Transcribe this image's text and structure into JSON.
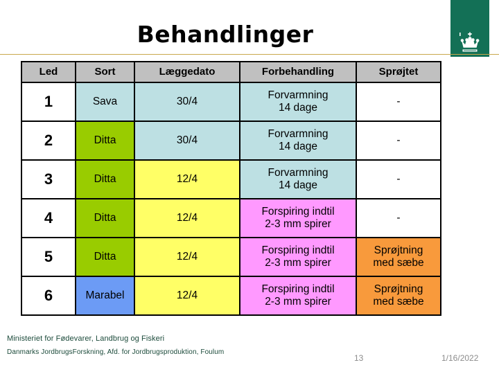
{
  "slide": {
    "title": "Behandlinger",
    "page_number": "13",
    "date": "1/16/2022",
    "accent_line_color": "#c8a84b"
  },
  "logo": {
    "name": "danish-ministry-crown-logo",
    "background_color": "#137056",
    "glyph_color": "#ffffff"
  },
  "footer": {
    "line1": "Ministeriet for Fødevarer, Landbrug og Fiskeri",
    "line2": "Danmarks JordbrugsForskning, Afd. for Jordbrugsproduktion, Foulum",
    "text_color": "#1b4a3a"
  },
  "table": {
    "headers": [
      "Led",
      "Sort",
      "Læggedato",
      "Forbehandling",
      "Sprøjtet"
    ],
    "header_background": "#c0c0c0",
    "palette": {
      "blue": "#bde0e3",
      "green": "#99cc00",
      "yellow": "#ffff66",
      "pink": "#ff99ff",
      "orange": "#f89a3c",
      "white": "#ffffff"
    },
    "rows": [
      {
        "led": "1",
        "sort": {
          "text": "Sava",
          "color": "blue"
        },
        "laeggedato": {
          "text": "30/4",
          "color": "blue"
        },
        "forbehandling": {
          "line1": "Forvarmning",
          "line2": "14 dage",
          "color": "blue"
        },
        "sprojtet": {
          "line1": "-",
          "line2": "",
          "color": "white"
        }
      },
      {
        "led": "2",
        "sort": {
          "text": "Ditta",
          "color": "green"
        },
        "laeggedato": {
          "text": "30/4",
          "color": "blue"
        },
        "forbehandling": {
          "line1": "Forvarmning",
          "line2": "14 dage",
          "color": "blue"
        },
        "sprojtet": {
          "line1": "-",
          "line2": "",
          "color": "white"
        }
      },
      {
        "led": "3",
        "sort": {
          "text": "Ditta",
          "color": "green"
        },
        "laeggedato": {
          "text": "12/4",
          "color": "yellow"
        },
        "forbehandling": {
          "line1": "Forvarmning",
          "line2": "14 dage",
          "color": "blue"
        },
        "sprojtet": {
          "line1": "-",
          "line2": "",
          "color": "white"
        }
      },
      {
        "led": "4",
        "sort": {
          "text": "Ditta",
          "color": "green"
        },
        "laeggedato": {
          "text": "12/4",
          "color": "yellow"
        },
        "forbehandling": {
          "line1": "Forspiring indtil",
          "line2": "2-3 mm spirer",
          "color": "pink"
        },
        "sprojtet": {
          "line1": "-",
          "line2": "",
          "color": "white"
        }
      },
      {
        "led": "5",
        "sort": {
          "text": "Ditta",
          "color": "green"
        },
        "laeggedato": {
          "text": "12/4",
          "color": "yellow"
        },
        "forbehandling": {
          "line1": "Forspiring indtil",
          "line2": "2-3 mm spirer",
          "color": "pink"
        },
        "sprojtet": {
          "line1": "Sprøjtning",
          "line2": "med sæbe",
          "color": "orange"
        }
      },
      {
        "led": "6",
        "sort": {
          "text": "Marabel",
          "color": "blue-strong"
        },
        "laeggedato": {
          "text": "12/4",
          "color": "yellow"
        },
        "forbehandling": {
          "line1": "Forspiring indtil",
          "line2": "2-3 mm spirer",
          "color": "pink"
        },
        "sprojtet": {
          "line1": "Sprøjtning",
          "line2": "med sæbe",
          "color": "orange"
        }
      }
    ]
  }
}
